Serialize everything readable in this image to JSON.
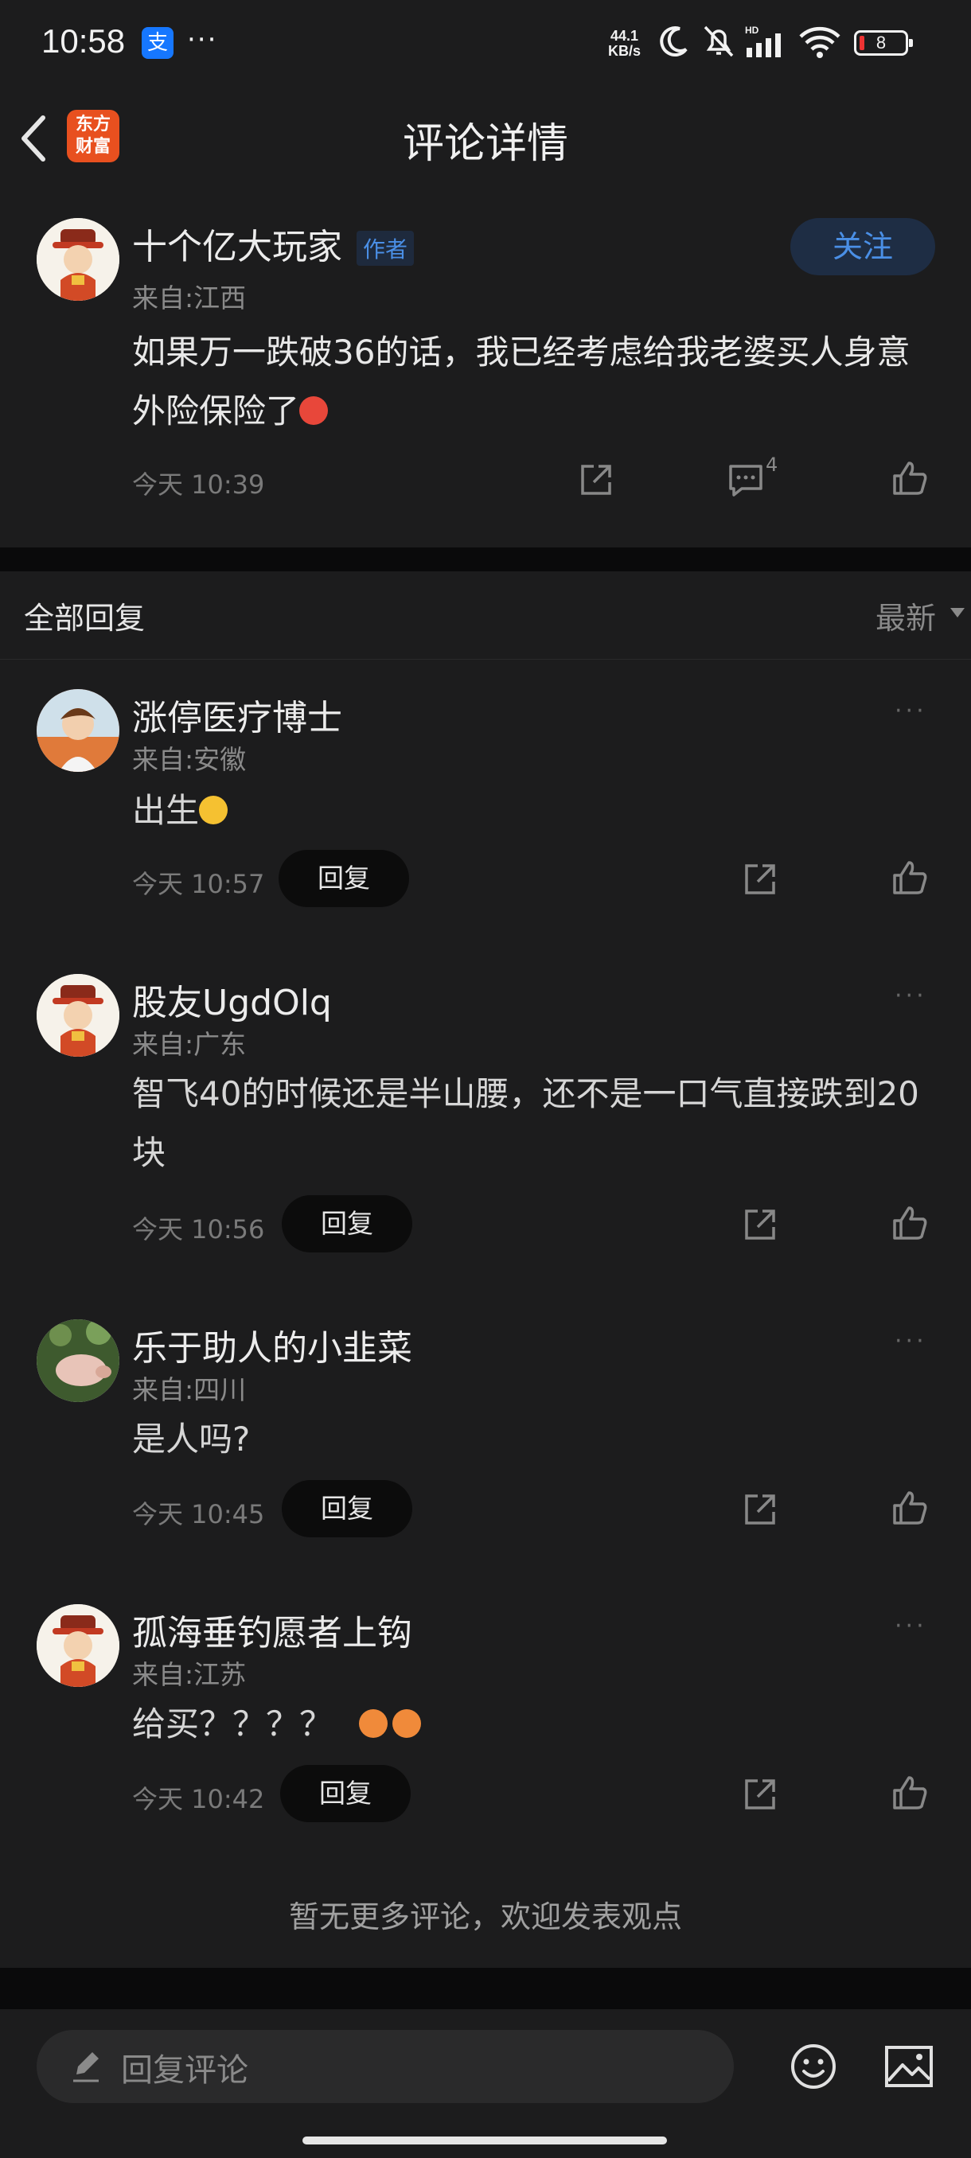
{
  "status_bar": {
    "time": "10:58",
    "alipay_glyph": "支",
    "dots": "···",
    "net_speed_top": "44.1",
    "net_speed_bottom": "KB/s",
    "battery": "8",
    "signal_tag": "HD"
  },
  "header": {
    "logo_line1": "东方",
    "logo_line2": "财富",
    "title": "评论详情"
  },
  "post": {
    "author": "十个亿大玩家",
    "author_badge": "作者",
    "region": "来自:江西",
    "follow_label": "关注",
    "text": "如果万一跌破36的话，我已经考虑给我老婆买人身意外险保险了",
    "time": "今天 10:39",
    "comment_count": "4"
  },
  "replies_section": {
    "title": "全部回复",
    "sort_label": "最新"
  },
  "replies": [
    {
      "name": "涨停医疗博士",
      "region": "来自:安徽",
      "text": "出生",
      "time": "今天 10:57",
      "reply_label": "回复"
    },
    {
      "name": "股友UgdOlq",
      "region": "来自:广东",
      "text": "智飞40的时候还是半山腰，还不是一口气直接跌到20块",
      "time": "今天 10:56",
      "reply_label": "回复"
    },
    {
      "name": "乐于助人的小韭菜",
      "region": "来自:四川",
      "text": "是人吗?",
      "time": "今天 10:45",
      "reply_label": "回复"
    },
    {
      "name": "孤海垂钓愿者上钩",
      "region": "来自:江苏",
      "text": "给买？？？？",
      "time": "今天 10:42",
      "reply_label": "回复"
    }
  ],
  "no_more": "暂无更多评论，欢迎发表观点",
  "bottom_bar": {
    "placeholder": "回复评论"
  },
  "colors": {
    "accent": "#4a8fe6",
    "logo": "#e8501f",
    "background": "#1c1c1d"
  }
}
